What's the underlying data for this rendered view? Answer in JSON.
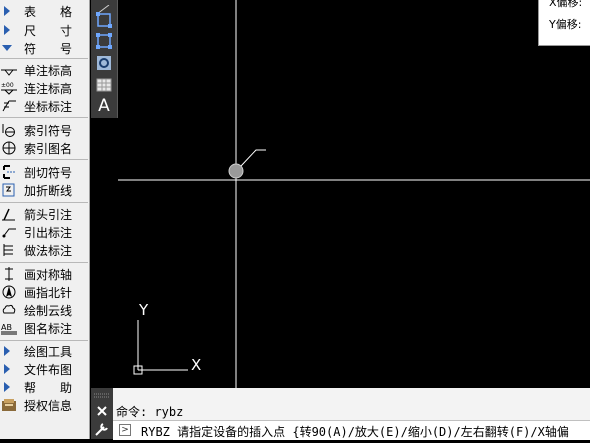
{
  "sidebar": {
    "categories_top": [
      {
        "label": "表格",
        "expanded": false
      },
      {
        "label": "尺寸",
        "expanded": false
      },
      {
        "label": "符号",
        "expanded": true
      }
    ],
    "groups": [
      [
        {
          "label": "单注标高",
          "icon": "elevation-single-icon"
        },
        {
          "label": "连注标高",
          "icon": "elevation-multi-icon"
        },
        {
          "label": "坐标标注",
          "icon": "coordinate-icon"
        }
      ],
      [
        {
          "label": "索引符号",
          "icon": "index-symbol-icon"
        },
        {
          "label": "索引图名",
          "icon": "index-drawing-icon"
        }
      ],
      [
        {
          "label": "剖切符号",
          "icon": "section-cut-icon"
        },
        {
          "label": "加折断线",
          "icon": "break-line-icon"
        }
      ],
      [
        {
          "label": "箭头引注",
          "icon": "arrow-leader-icon"
        },
        {
          "label": "引出标注",
          "icon": "leader-label-icon"
        },
        {
          "label": "做法标注",
          "icon": "method-label-icon"
        }
      ],
      [
        {
          "label": "画对称轴",
          "icon": "symmetry-axis-icon"
        },
        {
          "label": "画指北针",
          "icon": "north-arrow-icon"
        },
        {
          "label": "绘制云线",
          "icon": "cloud-line-icon"
        },
        {
          "label": "图名标注",
          "icon": "drawing-name-icon"
        }
      ]
    ],
    "categories_bottom": [
      {
        "label": "绘图工具",
        "icon": "triangle-right-icon"
      },
      {
        "label": "文件布图",
        "icon": "triangle-right-icon"
      },
      {
        "label": "帮助",
        "icon": "triangle-right-icon"
      },
      {
        "label": "授权信息",
        "icon": "authorization-icon"
      }
    ]
  },
  "vertical_toolbar": [
    "select-window-icon",
    "select-crossing-icon",
    "zoom-circle-icon",
    "table-icon",
    "text-a-icon"
  ],
  "vertical_toolbar_text": "A",
  "info_box": {
    "line1": "X偏移:",
    "line2": "Y偏移:"
  },
  "ucs": {
    "x_label": "X",
    "y_label": "Y"
  },
  "command": {
    "history": "命令: rybz",
    "prompt_icon": "command-prompt-icon",
    "current": "RYBZ 请指定设备的插入点 {转90(A)/放大(E)/缩小(D)/左右翻转(F)/X轴偏"
  },
  "colors": {
    "canvas_bg": "#000000",
    "crosshair": "#ffffff",
    "panel_bg": "#f0f0f0",
    "accent_blue": "#2a5fb0"
  }
}
